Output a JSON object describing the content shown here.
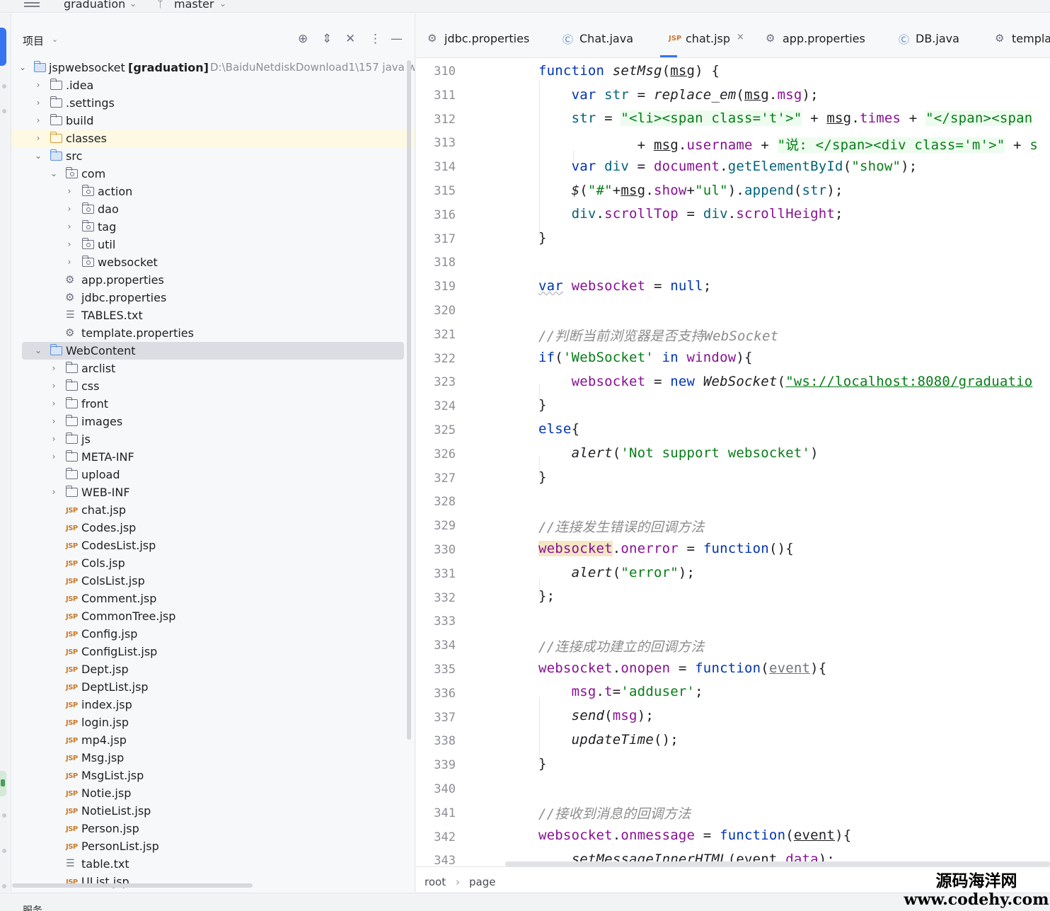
{
  "titlebar": {
    "project": "graduation",
    "branch": "master"
  },
  "project_panel": {
    "title": "项目",
    "root": {
      "name": "jspwebsocket",
      "module": "[graduation]",
      "path": "D:\\BaiduNetdiskDownload1\\157 java w"
    },
    "items": [
      {
        "label": ".idea"
      },
      {
        "label": ".settings"
      },
      {
        "label": "build"
      },
      {
        "label": "classes"
      },
      {
        "label": "src"
      },
      {
        "label": "com"
      },
      {
        "label": "action"
      },
      {
        "label": "dao"
      },
      {
        "label": "tag"
      },
      {
        "label": "util"
      },
      {
        "label": "websocket"
      },
      {
        "label": "app.properties"
      },
      {
        "label": "jdbc.properties"
      },
      {
        "label": "TABLES.txt"
      },
      {
        "label": "template.properties"
      },
      {
        "label": "WebContent"
      },
      {
        "label": "arclist"
      },
      {
        "label": "css"
      },
      {
        "label": "front"
      },
      {
        "label": "images"
      },
      {
        "label": "js"
      },
      {
        "label": "META-INF"
      },
      {
        "label": "upload"
      },
      {
        "label": "WEB-INF"
      },
      {
        "label": "chat.jsp"
      },
      {
        "label": "Codes.jsp"
      },
      {
        "label": "CodesList.jsp"
      },
      {
        "label": "Cols.jsp"
      },
      {
        "label": "ColsList.jsp"
      },
      {
        "label": "Comment.jsp"
      },
      {
        "label": "CommonTree.jsp"
      },
      {
        "label": "Config.jsp"
      },
      {
        "label": "ConfigList.jsp"
      },
      {
        "label": "Dept.jsp"
      },
      {
        "label": "DeptList.jsp"
      },
      {
        "label": "index.jsp"
      },
      {
        "label": "login.jsp"
      },
      {
        "label": "mp4.jsp"
      },
      {
        "label": "Msg.jsp"
      },
      {
        "label": "MsgList.jsp"
      },
      {
        "label": "Notie.jsp"
      },
      {
        "label": "NotieList.jsp"
      },
      {
        "label": "Person.jsp"
      },
      {
        "label": "PersonList.jsp"
      },
      {
        "label": "table.txt"
      },
      {
        "label": "UList.jsp"
      }
    ]
  },
  "tabs": [
    {
      "label": "jdbc.properties"
    },
    {
      "label": "Chat.java"
    },
    {
      "label": "chat.jsp"
    },
    {
      "label": "app.properties"
    },
    {
      "label": "DB.java"
    },
    {
      "label": "templa"
    }
  ],
  "editor": {
    "line_numbers": [
      "310",
      "311",
      "312",
      "313",
      "314",
      "315",
      "316",
      "317",
      "318",
      "319",
      "320",
      "321",
      "322",
      "323",
      "324",
      "325",
      "326",
      "327",
      "328",
      "329",
      "330",
      "331",
      "332",
      "333",
      "334",
      "335",
      "336",
      "337",
      "338",
      "339",
      "340",
      "341",
      "342",
      "343"
    ],
    "tokens": {
      "function": "function",
      "var": "var",
      "if": "if",
      "in": "in",
      "new": "new",
      "else": "else",
      "null": "null",
      "setMsg": "setMsg",
      "msg": "msg",
      "str": "str",
      "replace_em": "replace_em",
      "dotmsg": "msg",
      "s312": "\"<li><span class='t'>\"",
      "times": "times",
      "s312b": "\"</span><span",
      "username": "username",
      "s313": "\"说: </span><div class='m'>\"",
      "s313b": "s",
      "div": "div",
      "document": "document",
      "getElementById": "getElementById",
      "show_str": "\"show\"",
      "dollar": "$",
      "hash": "\"#\"",
      "show": "show",
      "ul": "\"ul\"",
      "append": "append",
      "scrollTop": "scrollTop",
      "scrollHeight": "scrollHeight",
      "websocket": "websocket",
      "c321": "//判断当前浏览器是否支持WebSocket",
      "ws_str": "'WebSocket'",
      "window": "window",
      "WebSocket": "WebSocket",
      "url": "\"ws://localhost:8080/graduatio",
      "alert": "alert",
      "not_support": "'Not support websocket'",
      "c329": "//连接发生错误的回调方法",
      "onerror": "onerror",
      "error": "\"error\"",
      "c334": "//连接成功建立的回调方法",
      "onopen": "onopen",
      "event": "event",
      "t": "t",
      "adduser": "'adduser'",
      "send": "send",
      "updateTime": "updateTime",
      "c341": "//接收到消息的回调方法",
      "onmessage": "onmessage",
      "setMessageInnerHTML": "setMessageInnerHTML",
      "data": "data"
    }
  },
  "breadcrumb": [
    "root",
    "page"
  ],
  "status": {
    "services": "服务"
  },
  "watermark": {
    "line1": "源码海洋网",
    "line2": "www.codehy.com"
  },
  "colors": {
    "accent": "#3574f0",
    "keyword": "#0033b3",
    "string": "#067d17",
    "property": "#871094",
    "function": "#00627a",
    "comment": "#8c8c8c"
  }
}
